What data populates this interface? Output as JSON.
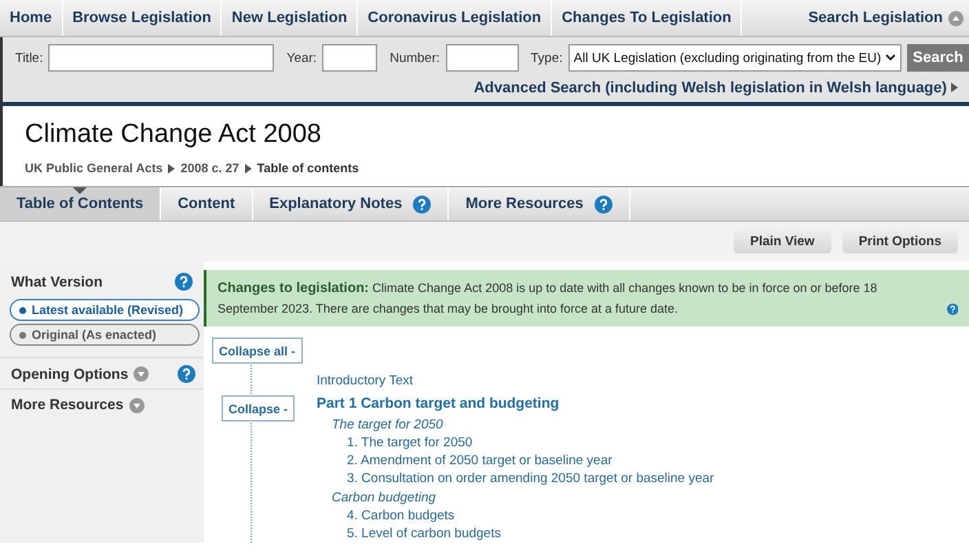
{
  "nav": {
    "items": [
      "Home",
      "Browse Legislation",
      "New Legislation",
      "Coronavirus Legislation",
      "Changes To Legislation"
    ],
    "search_link": "Search Legislation"
  },
  "search": {
    "fields": [
      {
        "label": "Title:"
      },
      {
        "label": "Year:"
      },
      {
        "label": "Number:"
      }
    ],
    "type_label": "Type:",
    "type_value": "All UK Legislation (excluding originating from the EU)",
    "button": "Search",
    "advanced": "Advanced Search (including Welsh legislation in Welsh language)"
  },
  "title": "Climate Change Act 2008",
  "breadcrumbs": [
    {
      "label": "UK Public General Acts",
      "link": true
    },
    {
      "label": "2008 c. 27",
      "link": true
    },
    {
      "label": "Table of contents",
      "link": false
    }
  ],
  "tabs": [
    {
      "label": "Table of Contents",
      "selected": true,
      "help": false
    },
    {
      "label": "Content",
      "selected": false,
      "help": false
    },
    {
      "label": "Explanatory Notes",
      "selected": false,
      "help": true
    },
    {
      "label": "More Resources",
      "selected": false,
      "help": true
    }
  ],
  "toolbar": [
    "Plain View",
    "Print Options"
  ],
  "sidebar": {
    "version_title": "What Version",
    "versions": [
      {
        "label": "Latest available (Revised)",
        "selected": true
      },
      {
        "label": "Original (As enacted)",
        "selected": false
      }
    ],
    "sections": [
      {
        "label": "Opening Options",
        "help": true
      },
      {
        "label": "More Resources",
        "help": false
      }
    ]
  },
  "banner": {
    "label": "Changes to legislation:",
    "text": "Climate Change Act 2008 is up to date with all changes known to be in force on or before 18 September 2023. There are changes that may be brought into force at a future date."
  },
  "tree": {
    "collapse_all": "Collapse all -",
    "collapse": "Collapse -",
    "intro": "Introductory Text",
    "part": "Part 1 Carbon target and budgeting",
    "groups": [
      {
        "heading": "The target for 2050",
        "items": [
          "1. The target for 2050",
          "2. Amendment of 2050 target or baseline year",
          "3. Consultation on order amending 2050 target or baseline year"
        ]
      },
      {
        "heading": "Carbon budgeting",
        "items": [
          "4. Carbon budgets",
          "5. Level of carbon budgets"
        ]
      }
    ]
  }
}
